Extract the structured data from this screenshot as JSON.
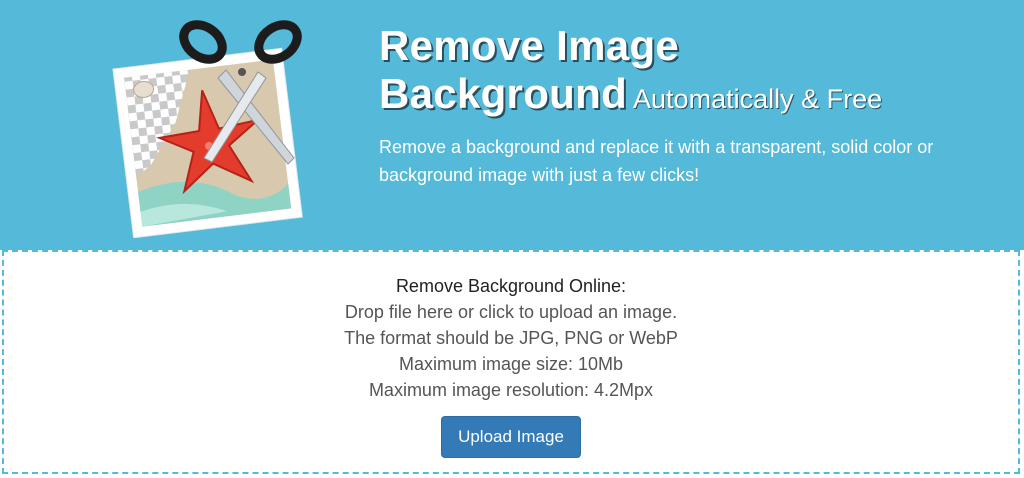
{
  "hero": {
    "title_line1": "Remove Image",
    "title_line2": "Background",
    "title_sub": "Automatically & Free",
    "description": "Remove a background and replace it with a transparent, solid color or background image with just a few clicks!",
    "logo_icon": "scissors-photo-starfish-icon",
    "background_color": "#55b9d9"
  },
  "upload": {
    "heading": "Remove Background Online:",
    "lines": [
      "Drop file here or click to upload an image.",
      "The format should be JPG, PNG or WebP",
      "Maximum image size: 10Mb",
      "Maximum image resolution: 4.2Mpx"
    ],
    "button_label": "Upload Image",
    "button_color": "#337ab7"
  }
}
